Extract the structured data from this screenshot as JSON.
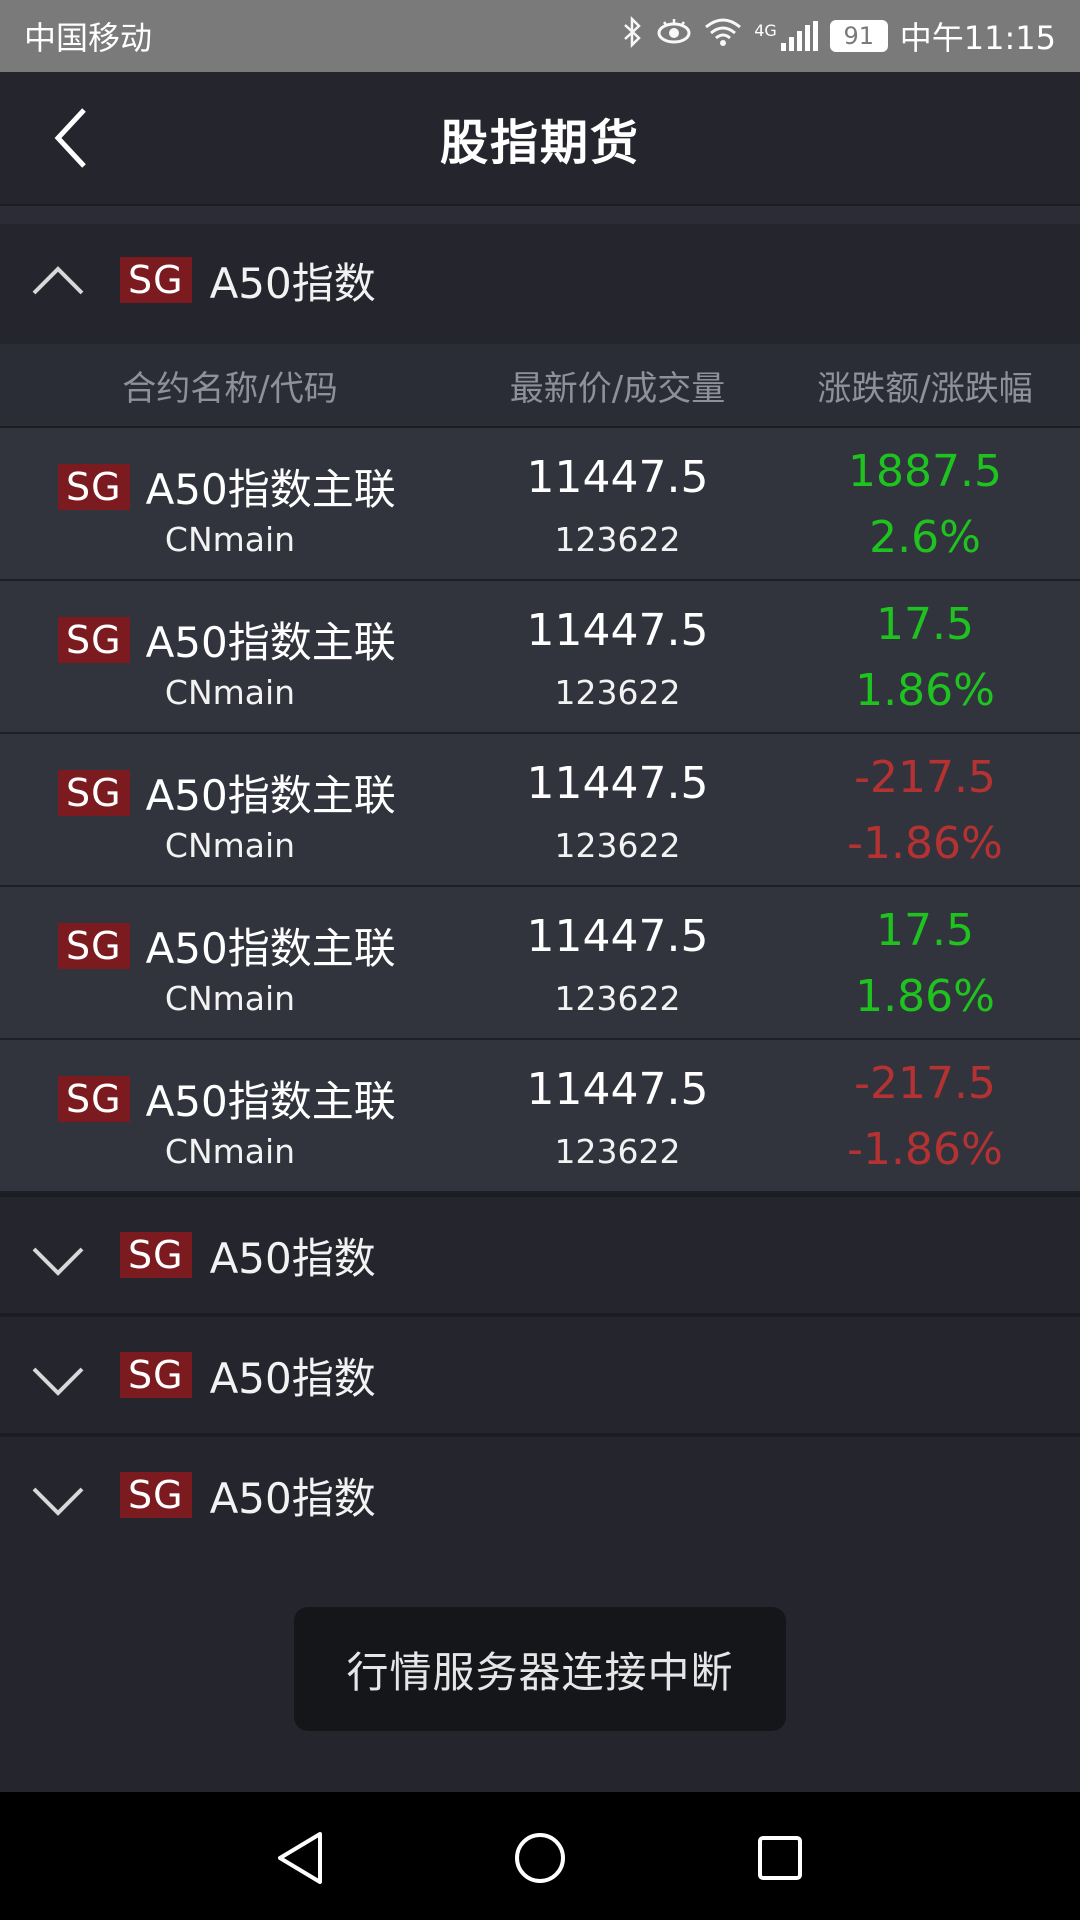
{
  "status_bar": {
    "carrier": "中国移动",
    "network": "4G",
    "battery": "91",
    "time": "中午11:15"
  },
  "app_bar": {
    "title": "股指期货",
    "back_icon": "chevron-left-icon"
  },
  "section_expanded": {
    "badge": "SG",
    "title": "A50指数",
    "chevron_icon": "chevron-up-icon"
  },
  "table": {
    "headers": [
      "合约名称/代码",
      "最新价/成交量",
      "涨跌额/涨跌幅"
    ],
    "rows": [
      {
        "badge": "SG",
        "name": "A50指数主联",
        "code": "CNmain",
        "price": "11447.5",
        "volume": "123622",
        "change": "1887.5",
        "pct": "2.6%",
        "trend": "up"
      },
      {
        "badge": "SG",
        "name": "A50指数主联",
        "code": "CNmain",
        "price": "11447.5",
        "volume": "123622",
        "change": "17.5",
        "pct": "1.86%",
        "trend": "up"
      },
      {
        "badge": "SG",
        "name": "A50指数主联",
        "code": "CNmain",
        "price": "11447.5",
        "volume": "123622",
        "change": "-217.5",
        "pct": "-1.86%",
        "trend": "down"
      },
      {
        "badge": "SG",
        "name": "A50指数主联",
        "code": "CNmain",
        "price": "11447.5",
        "volume": "123622",
        "change": "17.5",
        "pct": "1.86%",
        "trend": "up"
      },
      {
        "badge": "SG",
        "name": "A50指数主联",
        "code": "CNmain",
        "price": "11447.5",
        "volume": "123622",
        "change": "-217.5",
        "pct": "-1.86%",
        "trend": "down"
      }
    ]
  },
  "sections_collapsed": [
    {
      "badge": "SG",
      "title": "A50指数",
      "chevron_icon": "chevron-down-icon"
    },
    {
      "badge": "SG",
      "title": "A50指数",
      "chevron_icon": "chevron-down-icon"
    },
    {
      "badge": "SG",
      "title": "A50指数",
      "chevron_icon": "chevron-down-icon"
    }
  ],
  "toast": {
    "message": "行情服务器连接中断"
  },
  "colors": {
    "up": "#1fc31f",
    "down": "#b53233",
    "badge_bg": "#7c1b1f",
    "background": "#24252d"
  },
  "nav_bar": {
    "back_icon": "triangle-back-icon",
    "home_icon": "circle-home-icon",
    "recents_icon": "square-recents-icon"
  }
}
